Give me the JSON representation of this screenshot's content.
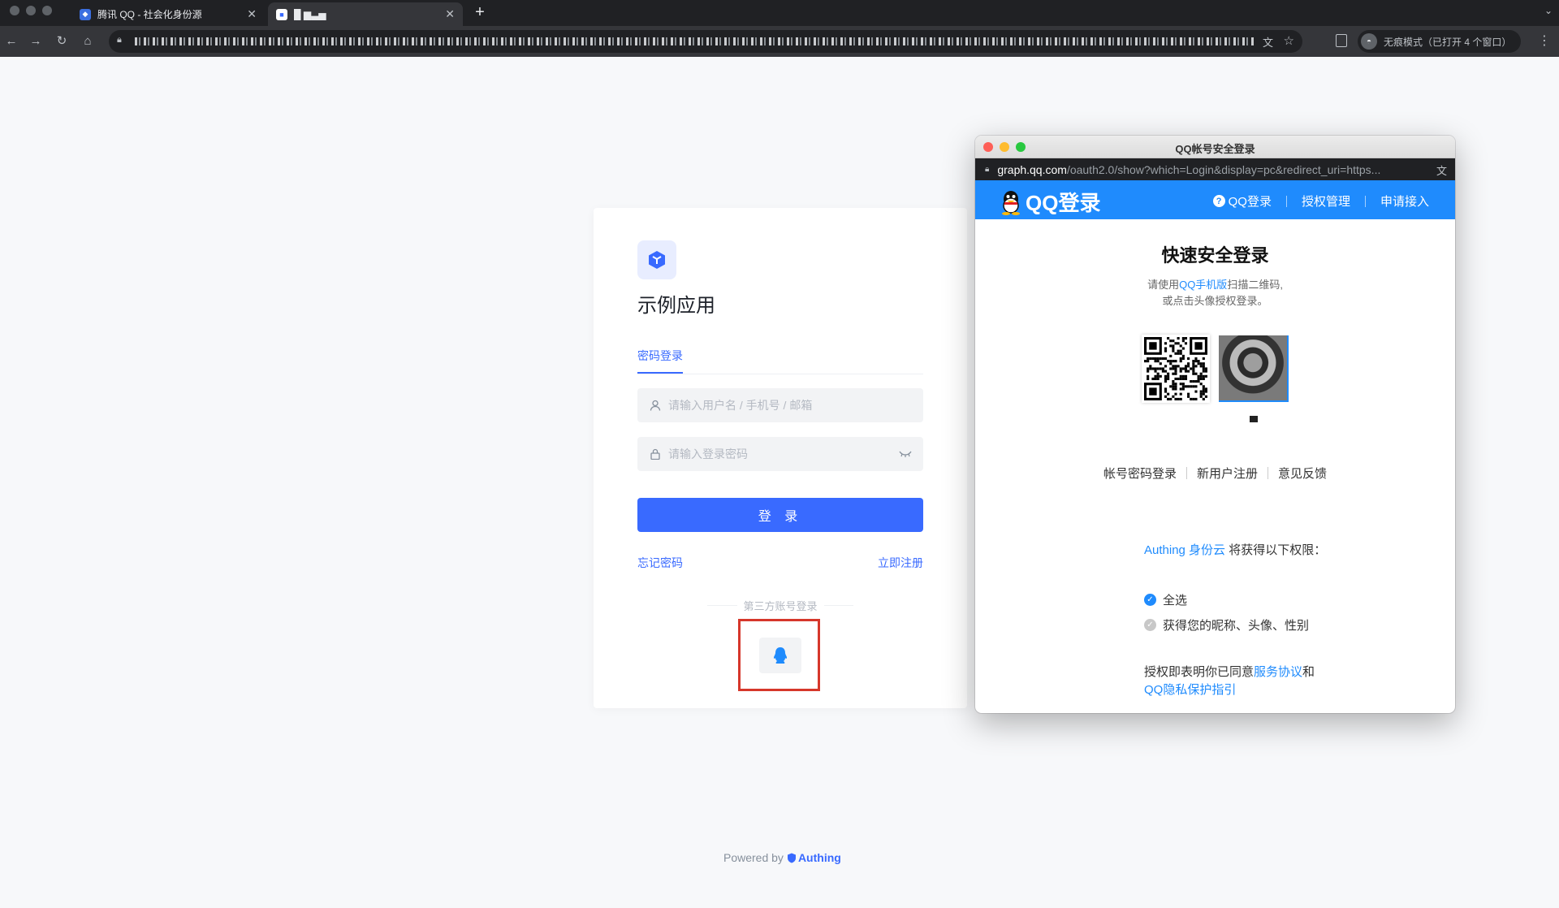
{
  "browser": {
    "tabs": [
      {
        "title": "腾讯 QQ - 社会化身份源",
        "close": "✕",
        "active": false
      },
      {
        "title": "█ ▆▃▅",
        "close": "✕",
        "active": true
      }
    ],
    "new_tab": "+",
    "incognito_label": "无痕模式（已打开 4 个窗口）"
  },
  "login": {
    "app_name": "示例应用",
    "tab_password": "密码登录",
    "username_placeholder": "请输入用户名 / 手机号 / 邮箱",
    "password_placeholder": "请输入登录密码",
    "login_button": "登 录",
    "forgot_password": "忘记密码",
    "register": "立即注册",
    "third_party_label": "第三方账号登录"
  },
  "footer": {
    "powered_by": "Powered by",
    "brand": "Authing"
  },
  "popup": {
    "window_title": "QQ帐号安全登录",
    "url_host": "graph.qq.com",
    "url_path": "/oauth2.0/show?which=Login&display=pc&redirect_uri=https...",
    "logo_text": "QQ登录",
    "nav": [
      "QQ登录",
      "授权管理",
      "申请接入"
    ],
    "title": "快速安全登录",
    "tip_prefix": "请使用",
    "tip_highlight": "QQ手机版",
    "tip_suffix": "扫描二维码,",
    "tip_line2": "或点击头像授权登录。",
    "links": [
      "帐号密码登录",
      "新用户注册",
      "意见反馈"
    ],
    "permission_app": "Authing 身份云",
    "permission_text": " 将获得以下权限：",
    "permissions": [
      {
        "label": "全选",
        "checked": true
      },
      {
        "label": "获得您的昵称、头像、性别",
        "checked": false
      }
    ],
    "agree_prefix": "授权即表明你已同意",
    "agree_service": "服务协议",
    "agree_and": "和",
    "agree_privacy": "QQ隐私保护指引"
  },
  "colors": {
    "accent": "#396aff",
    "qq_blue": "#1f8bfd",
    "highlight_border": "#d6372b"
  }
}
